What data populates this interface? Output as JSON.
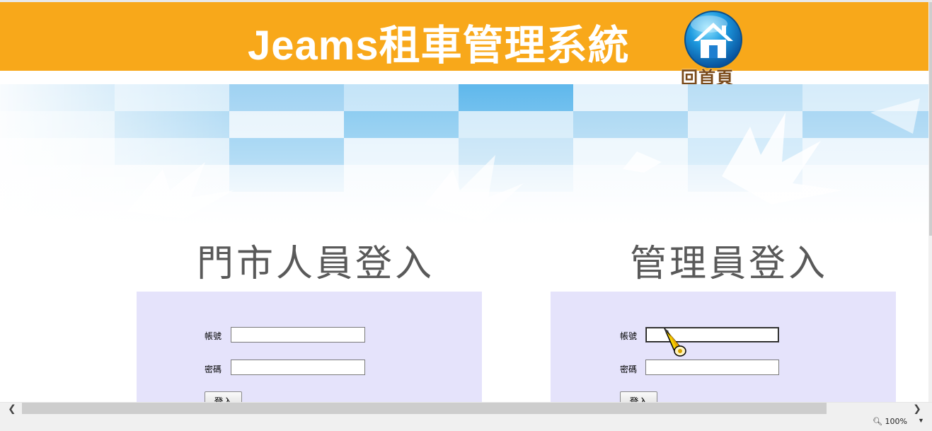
{
  "header": {
    "title": "Jeams租車管理系統",
    "home_label": "回首頁",
    "background_color": "#f8a81a"
  },
  "store_login": {
    "title": "門市人員登入",
    "account_label": "帳號",
    "account_value": "",
    "password_label": "密碼",
    "password_value": "",
    "submit_label": "登入"
  },
  "admin_login": {
    "title": "管理員登入",
    "account_label": "帳號",
    "account_value": "",
    "password_label": "密碼",
    "password_value": "",
    "submit_label": "登入"
  },
  "statusbar": {
    "zoom": "100%"
  },
  "icons": {
    "home": "home-icon",
    "cursor": "pencil-cursor-icon",
    "zoom": "magnifier-icon"
  }
}
